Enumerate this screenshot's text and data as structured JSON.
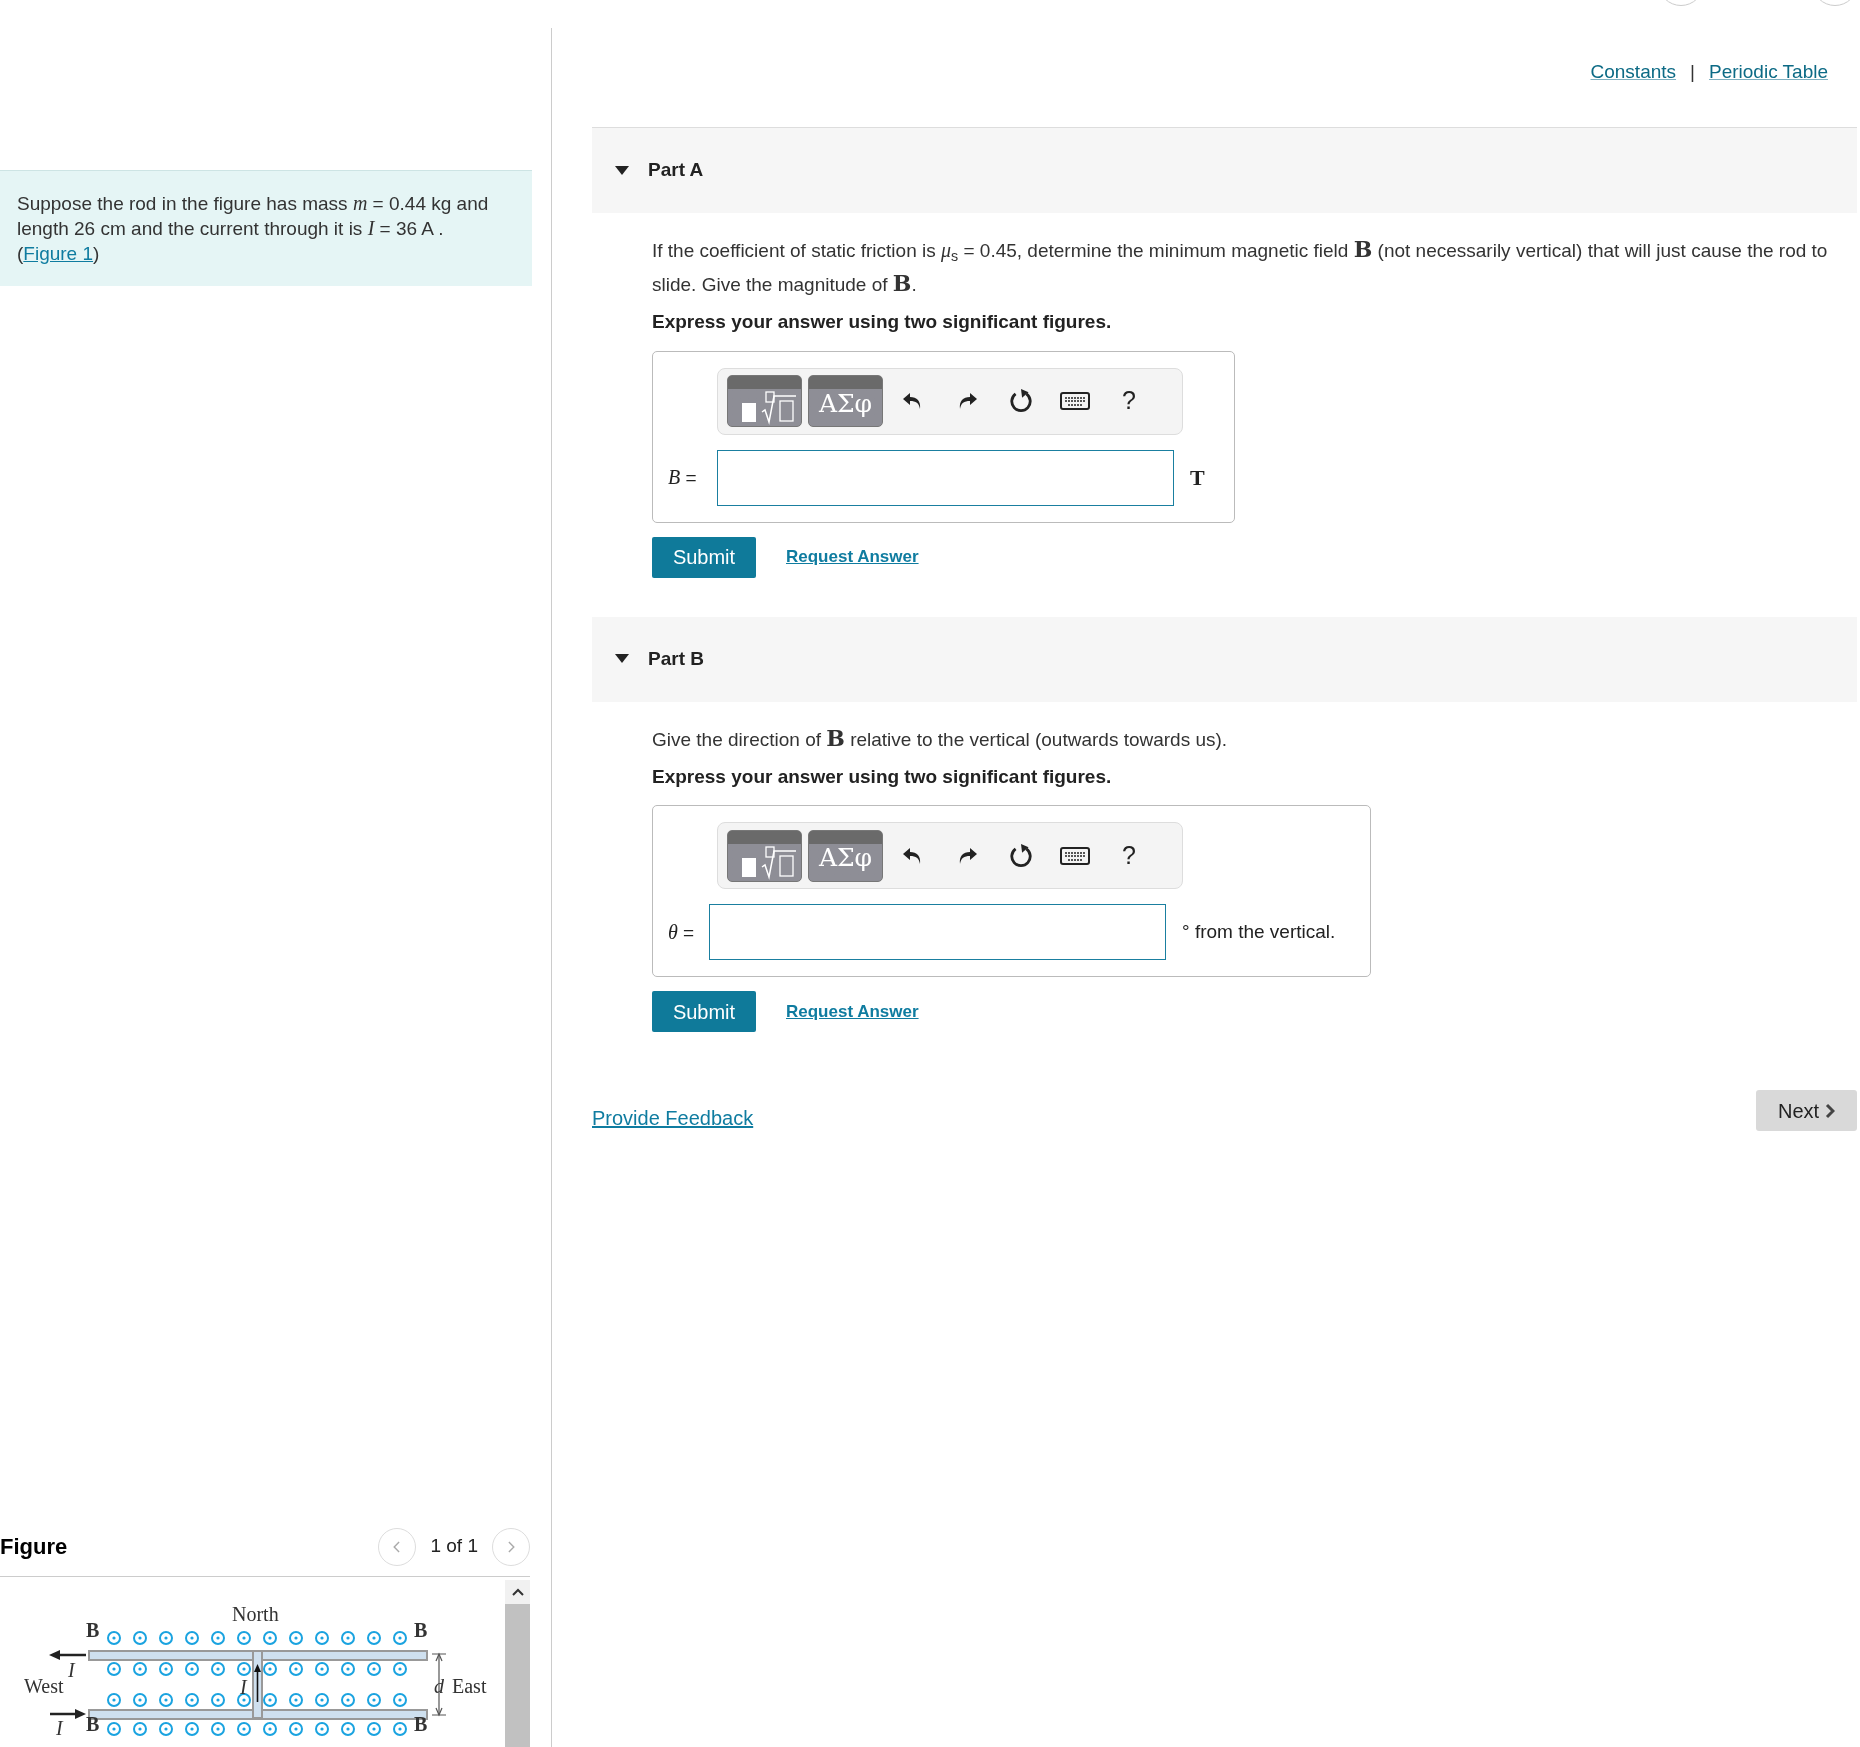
{
  "header_links": [
    {
      "label": "Constants"
    },
    {
      "label": "Periodic Table"
    }
  ],
  "separator": "|",
  "intro": {
    "text": "Suppose the rod in the figure has mass *m* = 0.44 kg and length 26 cm and the current through it is *I* = 36 A .",
    "link_prefix": "(",
    "link": "Figure 1",
    "link_suffix": ")"
  },
  "figure": {
    "title": "Figure",
    "pager": "1 of 1",
    "north": "North",
    "west": "West",
    "east": "East",
    "gap": "d",
    "field": [
      "B",
      "B",
      "B",
      "B"
    ],
    "current": [
      "I",
      "I",
      "I"
    ]
  },
  "parts": [
    {
      "title": "Part A",
      "expanded": true,
      "question": "If the coefficient of static friction is *μ*$_{s}$ = 0.45, determine the minimum magnetic field **B** (not necessarily vertical) that will just cause the rod to slide. Give the magnitude of **B**.",
      "instruction": "Express your answer using two significant figures.",
      "symbols": "ΑΣφ",
      "help": "?",
      "variable": "*B* =",
      "unit": "T",
      "kind": "serif",
      "submit": "Submit",
      "request": "Request Answer"
    },
    {
      "title": "Part B",
      "expanded": true,
      "question": "Give the direction of **B** relative to the vertical (outwards towards us).",
      "instruction": "Express your answer using two significant figures.",
      "symbols": "ΑΣφ",
      "help": "?",
      "variable": "*θ* =",
      "unit": "° from the vertical.",
      "kind": "text",
      "submit": "Submit",
      "request": "Request Answer"
    }
  ],
  "feedback_link": "Provide Feedback",
  "next_button": "Next"
}
